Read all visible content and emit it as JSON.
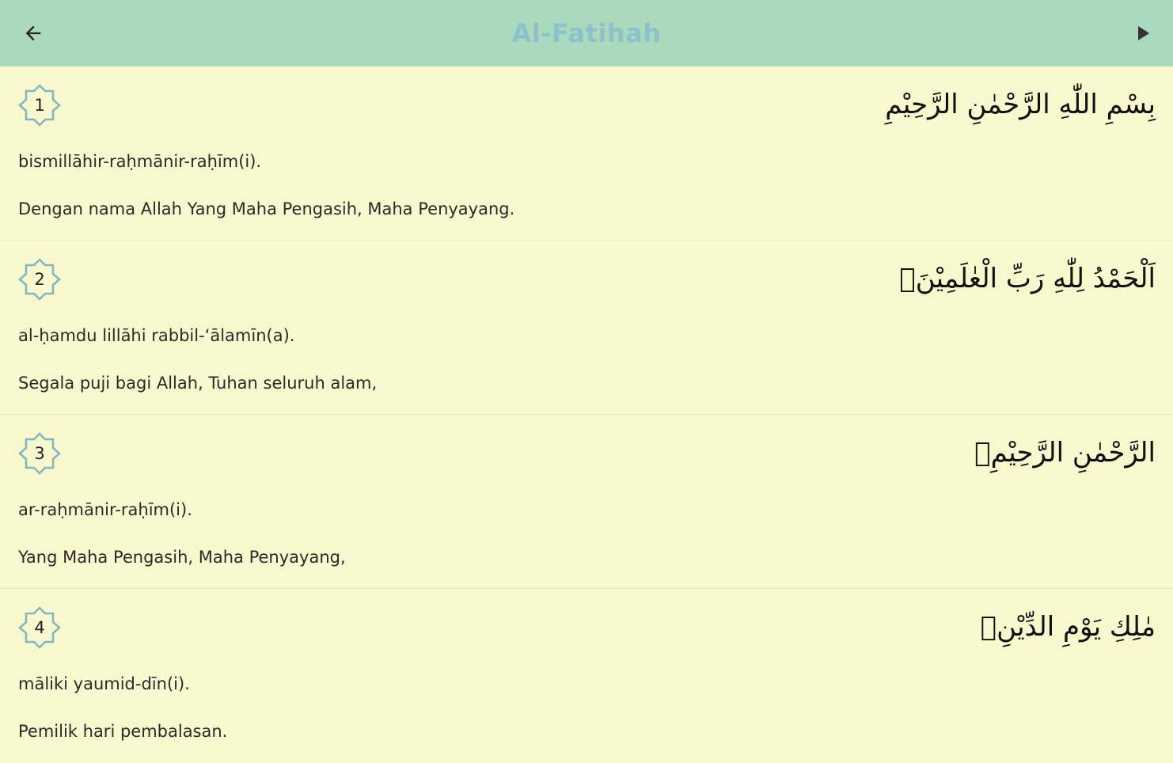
{
  "app_bar": {
    "title": "Al-Fatihah",
    "back_icon": "arrow-left-icon",
    "play_icon": "play-icon"
  },
  "colors": {
    "app_bar_bg": "#aad9be",
    "title_color": "#8cc2c9",
    "page_bg": "#f9f7cd",
    "badge_stroke": "#7fb8c0"
  },
  "ayahs": [
    {
      "number": "1",
      "arabic": "بِسْمِ اللّٰهِ الرَّحْمٰنِ الرَّحِيْمِ",
      "transliteration": "bismillāhir-raḥmānir-raḥīm(i).",
      "translation": "Dengan nama Allah Yang Maha Pengasih, Maha Penyayang."
    },
    {
      "number": "2",
      "arabic": "اَلْحَمْدُ لِلّٰهِ رَبِّ الْعٰلَمِيْنَۙ",
      "transliteration": "al-ḥamdu lillāhi rabbil-‘ālamīn(a).",
      "translation": "Segala puji bagi Allah, Tuhan seluruh alam,"
    },
    {
      "number": "3",
      "arabic": "الرَّحْمٰنِ الرَّحِيْمِۙ",
      "transliteration": "ar-raḥmānir-raḥīm(i).",
      "translation": "Yang Maha Pengasih, Maha Penyayang,"
    },
    {
      "number": "4",
      "arabic": "مٰلِكِ يَوْمِ الدِّيْنِۗ",
      "transliteration": "māliki yaumid-dīn(i).",
      "translation": "Pemilik hari pembalasan."
    }
  ]
}
